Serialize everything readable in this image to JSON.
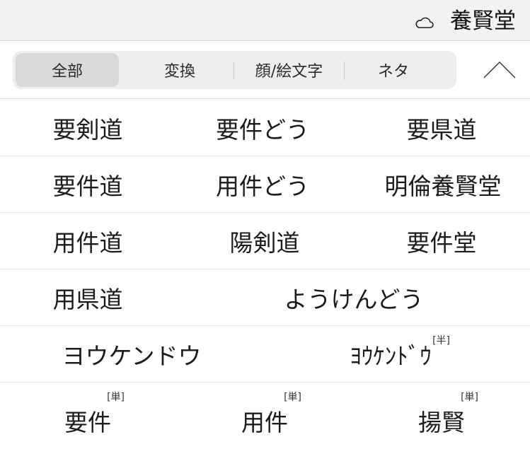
{
  "header": {
    "selected_word": "養賢堂",
    "cloud_icon": "cloud-icon"
  },
  "tabs": [
    {
      "label": "全部",
      "active": true
    },
    {
      "label": "変換",
      "active": false
    },
    {
      "label": "顔/絵文字",
      "active": false
    },
    {
      "label": "ネタ",
      "active": false
    }
  ],
  "collapse_icon": "chevron-up-icon",
  "candidates": [
    [
      "要剣道",
      "要件どう",
      "要県道"
    ],
    [
      "要件道",
      "用件どう",
      "明倫養賢堂"
    ],
    [
      "用件道",
      "陽剣道",
      "要件堂"
    ],
    [
      "用県道",
      "ようけんどう"
    ],
    [
      "ヨウケンドウ",
      "ﾖｳｹﾝﾄﾞｳ"
    ],
    [
      "要件",
      "用件",
      "揚賢"
    ]
  ],
  "badges": {
    "half_width": "[半]",
    "single_kanji": "[単]"
  },
  "colors": {
    "top_bar_bg": "#f2f2f3",
    "tab_bg": "#eeeeef",
    "tab_active_bg": "#d9d9db",
    "divider": "#e3e3e5"
  }
}
